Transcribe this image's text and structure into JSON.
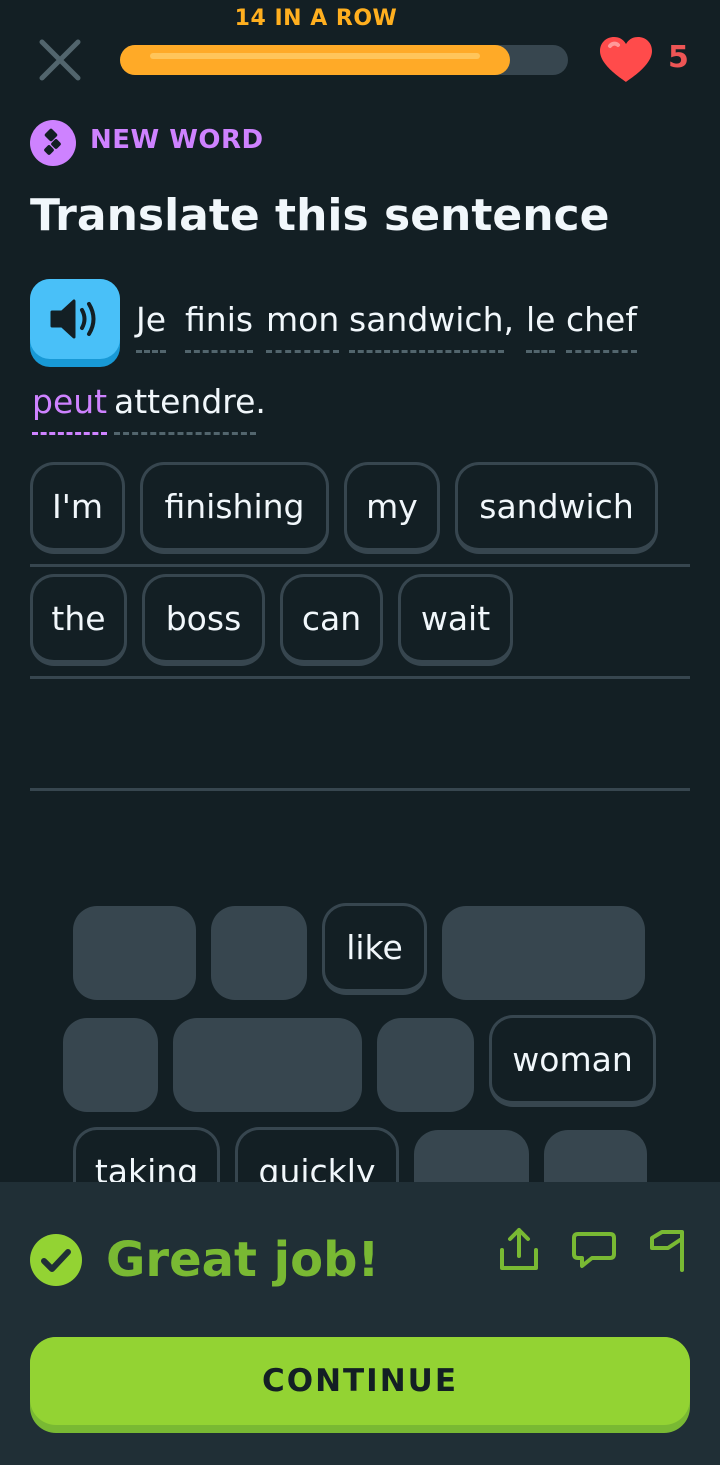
{
  "header": {
    "streak_text": "14 IN A ROW",
    "progress_fraction": 0.87,
    "hearts": "5",
    "close_icon": "close-icon",
    "heart_icon": "heart-icon"
  },
  "badge": {
    "label": "NEW WORD",
    "icon": "new-word-icon"
  },
  "title": "Translate this sentence",
  "prompt": {
    "speaker_icon": "speaker-icon",
    "words": [
      "Je",
      "finis",
      "mon",
      "sandwich,",
      "le",
      "chef",
      "peut",
      "attendre."
    ],
    "new_word": "peut"
  },
  "answer_tiles": [
    "I'm",
    "finishing",
    "my",
    "sandwich",
    "the",
    "boss",
    "can",
    "wait"
  ],
  "bank_tiles": [
    "like",
    "woman",
    "taking",
    "quickly"
  ],
  "feedback": {
    "message": "Great job!",
    "check_icon": "check-circle-icon",
    "share_icon": "share-icon",
    "comment_icon": "comment-icon",
    "flag_icon": "flag-icon",
    "continue_label": "CONTINUE"
  },
  "colors": {
    "background": "#131f24",
    "accent_orange": "#ffaa27",
    "accent_purple": "#ce82ff",
    "accent_green": "#93d333",
    "heart_red": "#ff4b4b",
    "speaker_blue": "#49c0f8"
  }
}
